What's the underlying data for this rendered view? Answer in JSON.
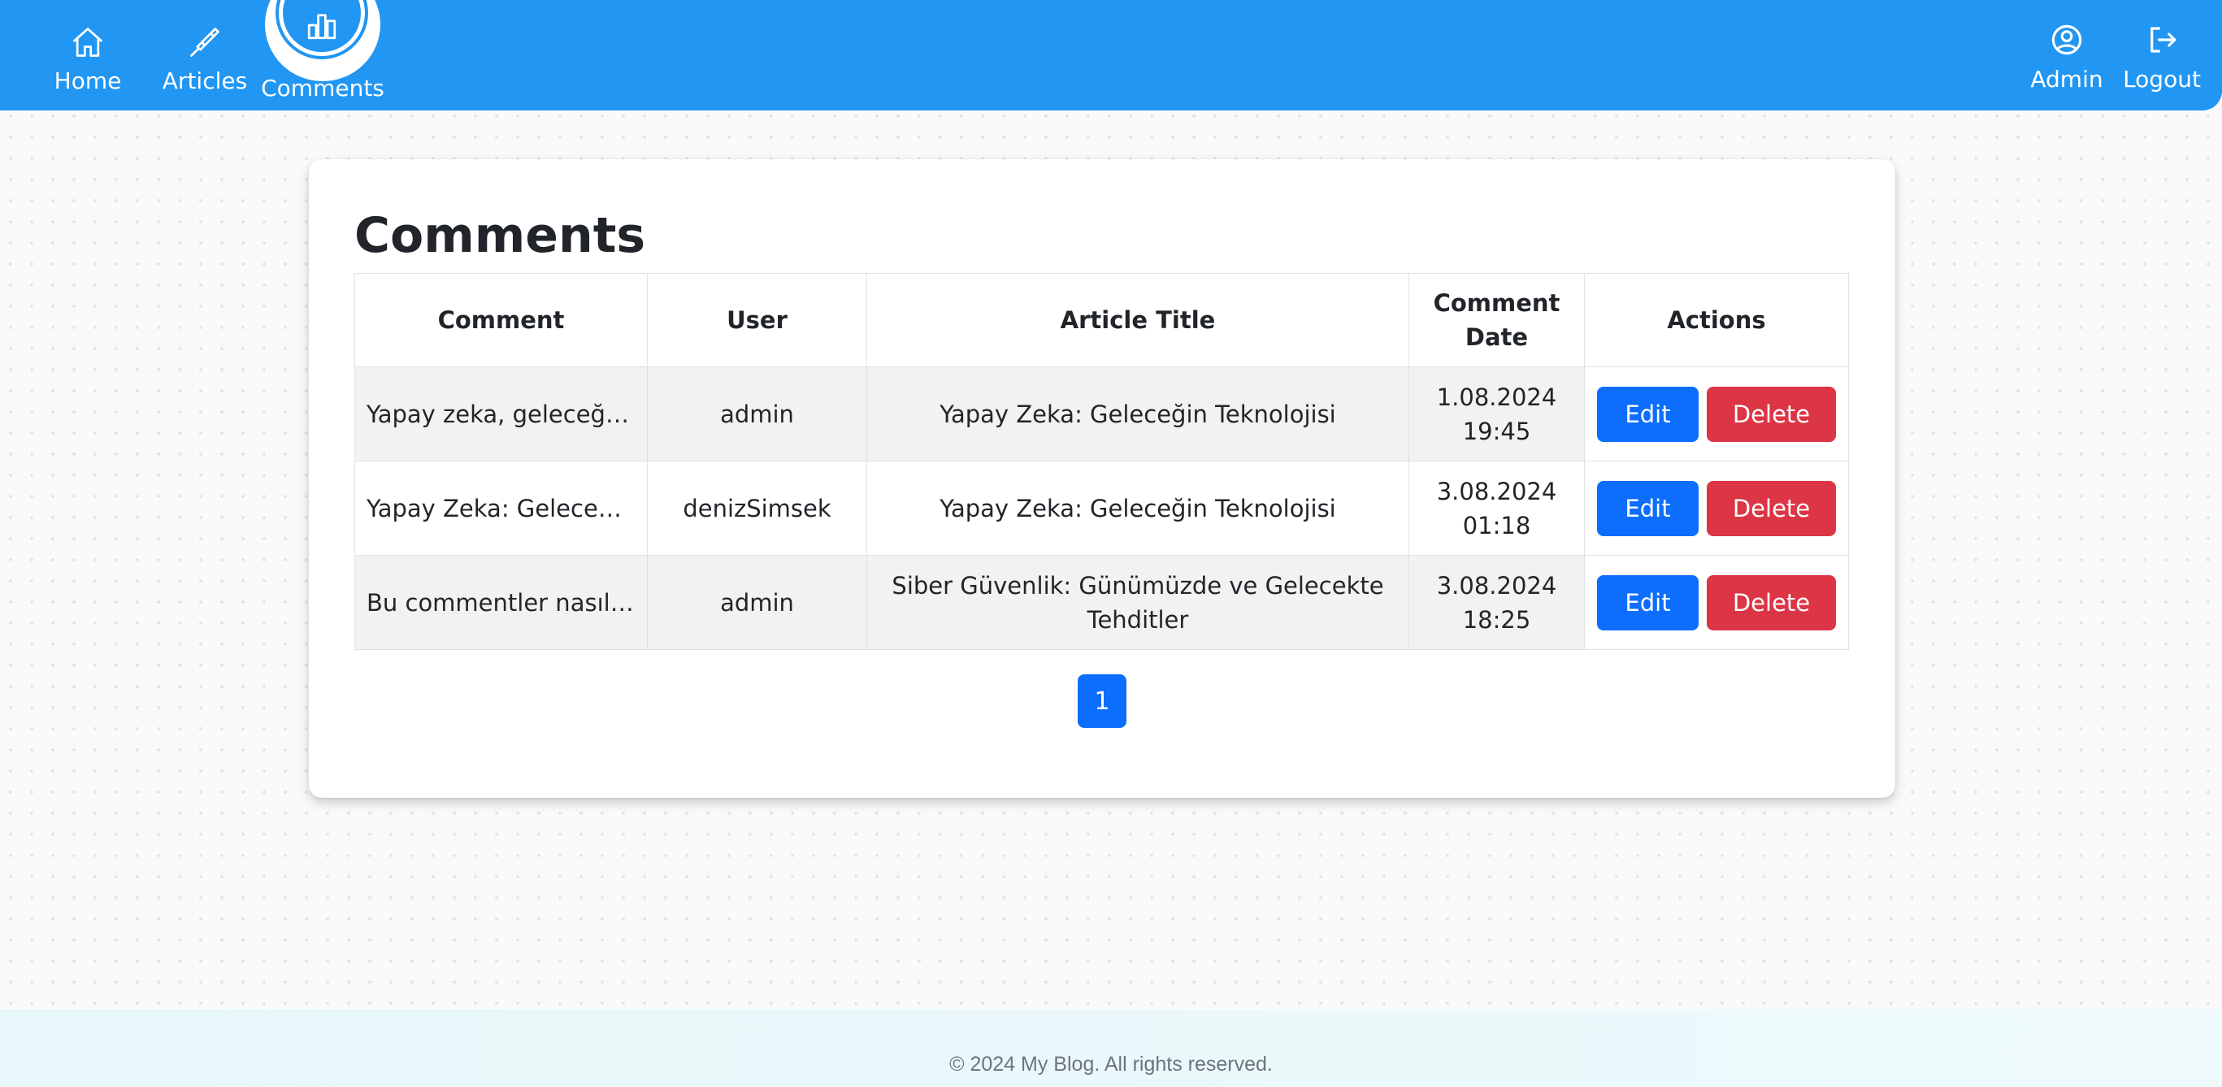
{
  "nav": {
    "home_label": "Home",
    "articles_label": "Articles",
    "comments_label": "Comments",
    "admin_label": "Admin",
    "logout_label": "Logout",
    "active_tab": "comments"
  },
  "main": {
    "title": "Comments",
    "table": {
      "headers": {
        "comment": "Comment",
        "user": "User",
        "article_title": "Article Title",
        "comment_date": "Comment Date",
        "actions": "Actions"
      },
      "rows": [
        {
          "comment": "Yapay zeka, geleceğin te...",
          "user": "admin",
          "article_title": "Yapay Zeka: Geleceğin Teknolojisi",
          "date": "1.08.2024",
          "time": "19:45",
          "edit_label": "Edit",
          "delete_label": "Delete"
        },
        {
          "comment": "Yapay Zeka: Geleceğin T...",
          "user": "denizSimsek",
          "article_title": "Yapay Zeka: Geleceğin Teknolojisi",
          "date": "3.08.2024",
          "time": "01:18",
          "edit_label": "Edit",
          "delete_label": "Delete"
        },
        {
          "comment": "Bu commentler nasıl edi...",
          "user": "admin",
          "article_title": "Siber Güvenlik: Günümüzde ve Gelecekte Tehditler",
          "date": "3.08.2024",
          "time": "18:25",
          "edit_label": "Edit",
          "delete_label": "Delete"
        }
      ]
    },
    "pagination": {
      "current_page": "1"
    }
  },
  "footer": {
    "text": "© 2024 My Blog. All rights reserved."
  },
  "colors": {
    "navbar": "#2196f3",
    "edit_button": "#0d6efd",
    "delete_button": "#dc3545",
    "striped_row": "#f2f2f2"
  }
}
